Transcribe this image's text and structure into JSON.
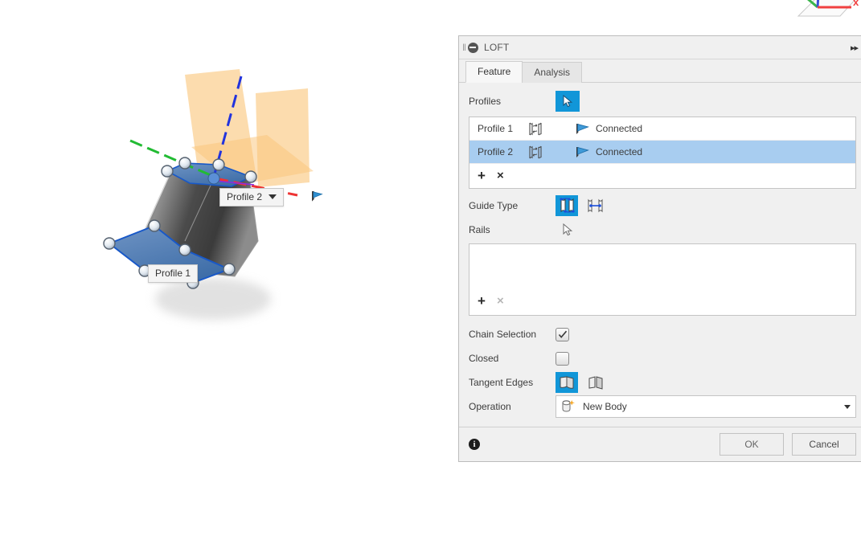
{
  "app": {
    "viewport_background": "#ffffff"
  },
  "viewport": {
    "axis_gizmo": {
      "x_label": "x",
      "x_color": "#f04040",
      "y_color": "#3ab54a",
      "z_color": "#3b4fd8"
    },
    "labels": [
      {
        "text": "Profile 2",
        "has_dropdown": true
      },
      {
        "text": "Profile 1",
        "has_dropdown": false
      }
    ],
    "colors": {
      "plane_fill": "#fac478",
      "profile_fill": "#4f82bd",
      "profile_edge": "#1858c8",
      "body_surface": "#6f6f6f",
      "axis_x": "#ee3333",
      "axis_y": "#22bb33",
      "axis_z": "#2233dd"
    }
  },
  "panel": {
    "title": "LOFT",
    "grip_icon": "grip-handle-icon",
    "collapse_icon": "collapse-circle-icon",
    "expand_icon": "double-chevron-right-icon",
    "tabs": [
      {
        "label": "Feature",
        "active": true
      },
      {
        "label": "Analysis",
        "active": false
      }
    ],
    "profiles": {
      "label": "Profiles",
      "select_icon": "cursor-select-icon",
      "rows": [
        {
          "name": "Profile 1",
          "section_icon": "loft-section-icon",
          "condition_icon": "connected-flag-icon",
          "condition": "Connected",
          "selected": false
        },
        {
          "name": "Profile 2",
          "section_icon": "loft-section-icon",
          "condition_icon": "connected-flag-icon",
          "condition": "Connected",
          "selected": true
        }
      ],
      "add_label": "+",
      "remove_label": "×"
    },
    "guide_type": {
      "label": "Guide Type",
      "options": [
        {
          "icon": "rails-guide-icon",
          "active": true
        },
        {
          "icon": "centerline-guide-icon",
          "active": false
        }
      ]
    },
    "rails": {
      "label": "Rails",
      "cursor_icon": "cursor-arrow-icon",
      "items": [],
      "add_label": "+",
      "remove_label": "×"
    },
    "chain_selection": {
      "label": "Chain Selection",
      "checked": true
    },
    "closed": {
      "label": "Closed",
      "checked": false
    },
    "tangent_edges": {
      "label": "Tangent Edges",
      "options": [
        {
          "icon": "tangent-merge-icon",
          "active": true
        },
        {
          "icon": "tangent-keep-icon",
          "active": false
        }
      ]
    },
    "operation": {
      "label": "Operation",
      "value": "New Body",
      "value_icon": "new-body-icon",
      "caret_icon": "chevron-down-icon"
    },
    "footer": {
      "info_icon": "info-icon",
      "info_glyph": "i",
      "ok_label": "OK",
      "cancel_label": "Cancel"
    },
    "accent_color": "#1196d8",
    "selected_row_color": "#a8cdf0"
  }
}
